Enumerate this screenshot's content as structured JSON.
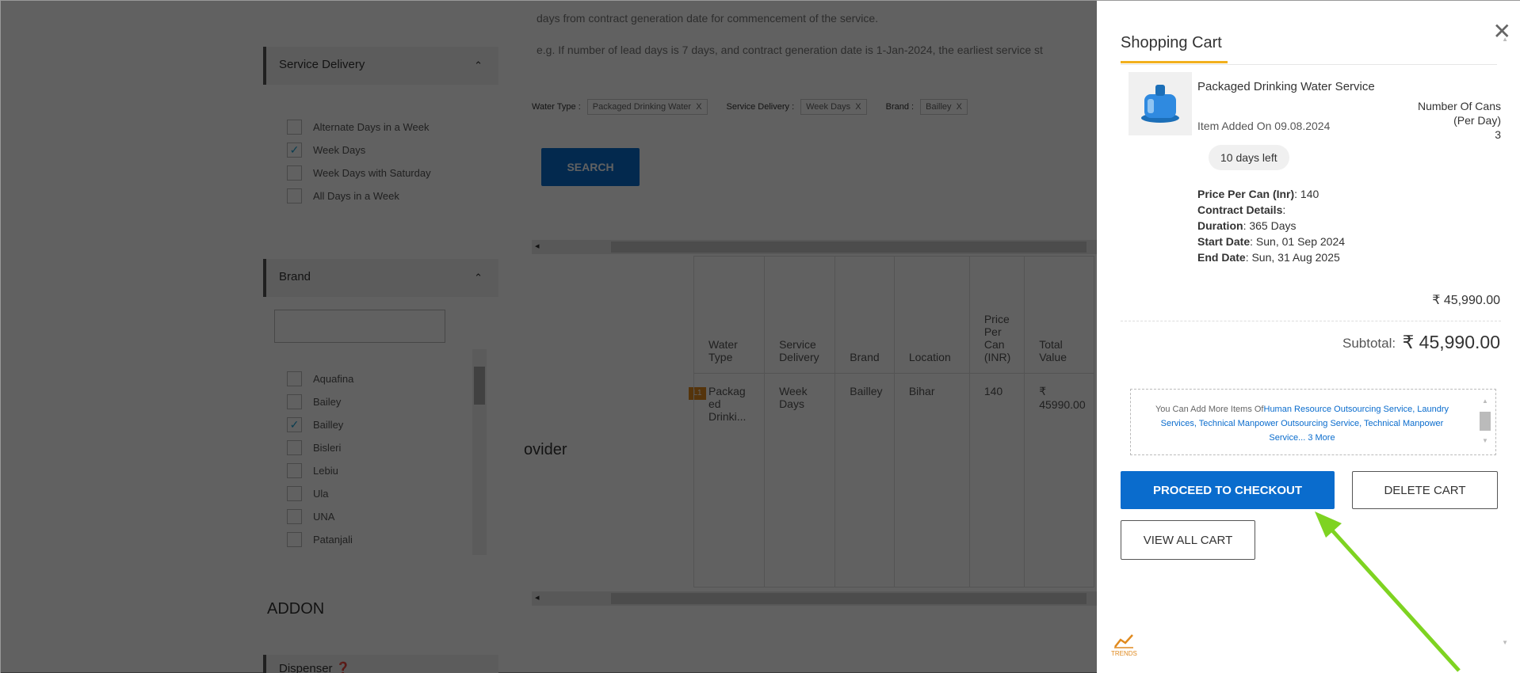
{
  "info": {
    "line1": "days from contract generation date for commencement of the service.",
    "line2": "e.g. If number of lead days is 7 days, and contract generation date is 1-Jan-2024, the earliest service st"
  },
  "sidebar": {
    "service_delivery": {
      "title": "Service Delivery",
      "options": [
        {
          "label": "Alternate Days in a Week",
          "checked": false
        },
        {
          "label": "Week Days",
          "checked": true
        },
        {
          "label": "Week Days with Saturday",
          "checked": false
        },
        {
          "label": "All Days in a Week",
          "checked": false
        }
      ]
    },
    "brand": {
      "title": "Brand",
      "options": [
        {
          "label": "Aquafina",
          "checked": false
        },
        {
          "label": "Bailey",
          "checked": false
        },
        {
          "label": "Bailley",
          "checked": true
        },
        {
          "label": "Bisleri",
          "checked": false
        },
        {
          "label": "Lebiu",
          "checked": false
        },
        {
          "label": "Ula",
          "checked": false
        },
        {
          "label": "UNA",
          "checked": false
        },
        {
          "label": "Patanjali",
          "checked": false
        }
      ]
    },
    "addon_label": "ADDON",
    "dispenser_label": "Dispenser"
  },
  "filters": {
    "water_type_label": "Water Type :",
    "water_type_value": "Packaged Drinking Water",
    "service_delivery_label": "Service Delivery :",
    "service_delivery_value": "Week Days",
    "brand_label": "Brand :",
    "brand_value": "Bailley",
    "remove": "X"
  },
  "search_label": "SEARCH",
  "table": {
    "headers": [
      "Water Type",
      "Service Delivery",
      "Brand",
      "Location",
      "Price Per Can (INR)",
      "Total Value"
    ],
    "row": [
      "Packag ed Drinki...",
      "Week Days",
      "Bailley",
      "Bihar",
      "140",
      "₹ 45990.00"
    ],
    "provider_text": "ovider",
    "badge": "L1"
  },
  "cart": {
    "title": "Shopping Cart",
    "item": {
      "name": "Packaged Drinking Water Service",
      "added_on": "Item Added On 09.08.2024",
      "days_left": "10 days left",
      "qty_label": "Number Of Cans (Per Day)",
      "qty_value": "3",
      "price_label": "Price Per Can (Inr)",
      "price_value": ": 140",
      "contract_label": "Contract Details",
      "duration_label": "Duration",
      "duration_value": ": 365 Days",
      "start_label": "Start Date",
      "start_value": ": Sun, 01 Sep 2024",
      "end_label": "End Date",
      "end_value": ": Sun, 31 Aug 2025",
      "total": "₹ 45,990.00"
    },
    "subtotal_label": "Subtotal:",
    "subtotal_value": "₹ 45,990.00",
    "promo_prefix": "You Can Add More Items Of",
    "promo_links": "Human Resource Outsourcing Service, Laundry Services, Technical Manpower Outsourcing Service, Technical Manpower Service... 3 More",
    "checkout_label": "PROCEED TO CHECKOUT",
    "delete_label": "DELETE CART",
    "view_all_label": "VIEW ALL CART",
    "trends_label": "TRENDS"
  },
  "colors": {
    "primary": "#0a6ccd",
    "accent": "#f2b01e",
    "checkmark": "#1ea0d2",
    "annotation_arrow": "#7ed321"
  }
}
